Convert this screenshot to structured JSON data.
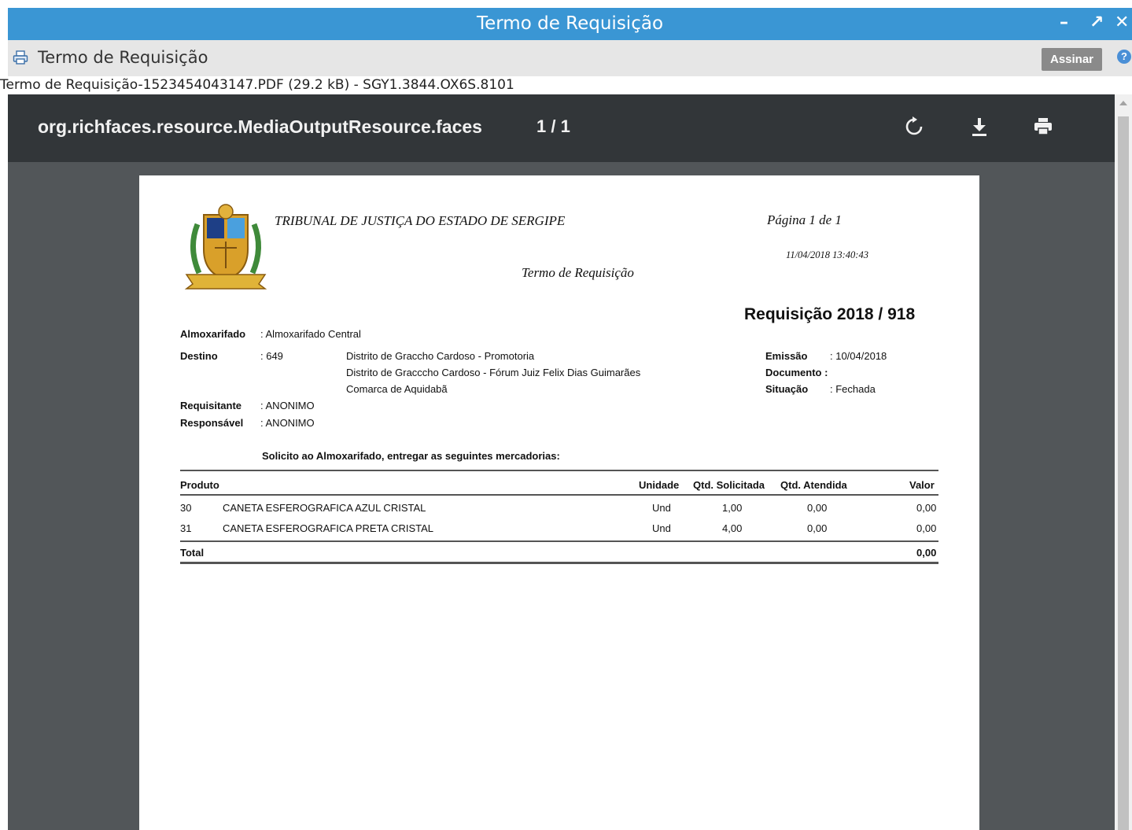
{
  "window": {
    "title": "Termo de Requisição",
    "toolbar_label": "Termo de Requisição",
    "sign_button": "Assinar",
    "help_glyph": "?",
    "file_info": "Termo de Requisição-1523454043147.PDF (29.2 kB) - SGY1.3844.OX6S.8101",
    "buttons": [
      "minimize-icon",
      "maximize-icon",
      "close-icon"
    ]
  },
  "viewer": {
    "title": "org.richfaces.resource.MediaOutputResource.faces",
    "pages": "1 / 1",
    "icons": [
      "rotate-icon",
      "download-icon",
      "print-icon"
    ]
  },
  "document": {
    "court": "TRIBUNAL DE JUSTIÇA DO ESTADO DE SERGIPE",
    "page_label": "Página 1 de 1",
    "datetime": "11/04/2018  13:40:43",
    "doc_title": "Termo de Requisição",
    "req_title": "Requisição 2018 / 918",
    "almoxarifado_label": "Almoxarifado",
    "almoxarifado_value": ":  Almoxarifado Central",
    "destino_label": "Destino",
    "destino_code": ":  649",
    "destino_lines": [
      "Distrito de Graccho Cardoso - Promotoria",
      "Distrito de Gracccho Cardoso - Fórum Juiz Felix Dias Guimarães",
      "Comarca de Aquidabã"
    ],
    "requisitante_label": "Requisitante",
    "requisitante_value": ":  ANONIMO",
    "responsavel_label": "Responsável",
    "responsavel_value": ":  ANONIMO",
    "emissao_label": "Emissão",
    "emissao_value": ":  10/04/2018",
    "documento_label": "Documento :",
    "situacao_label": "Situação",
    "situacao_value": ":  Fechada",
    "request_text": "Solicito ao Almoxarifado, entregar as seguintes mercadorias:",
    "table": {
      "headers": {
        "produto": "Produto",
        "unidade": "Unidade",
        "qtd_solicitada": "Qtd. Solicitada",
        "qtd_atendida": "Qtd. Atendida",
        "valor": "Valor"
      },
      "rows": [
        {
          "code": "30",
          "name": "CANETA ESFEROGRAFICA AZUL CRISTAL",
          "unit": "Und",
          "qsol": "1,00",
          "qat": "0,00",
          "valor": "0,00"
        },
        {
          "code": "31",
          "name": "CANETA ESFEROGRAFICA PRETA CRISTAL",
          "unit": "Und",
          "qsol": "4,00",
          "qat": "0,00",
          "valor": "0,00"
        }
      ],
      "total_label": "Total",
      "total_value": "0,00"
    }
  },
  "colors": {
    "titlebar": "#3a96d4",
    "viewer_bg": "#525659",
    "viewer_toolbar": "#323639",
    "button": "#8a8a8a"
  }
}
